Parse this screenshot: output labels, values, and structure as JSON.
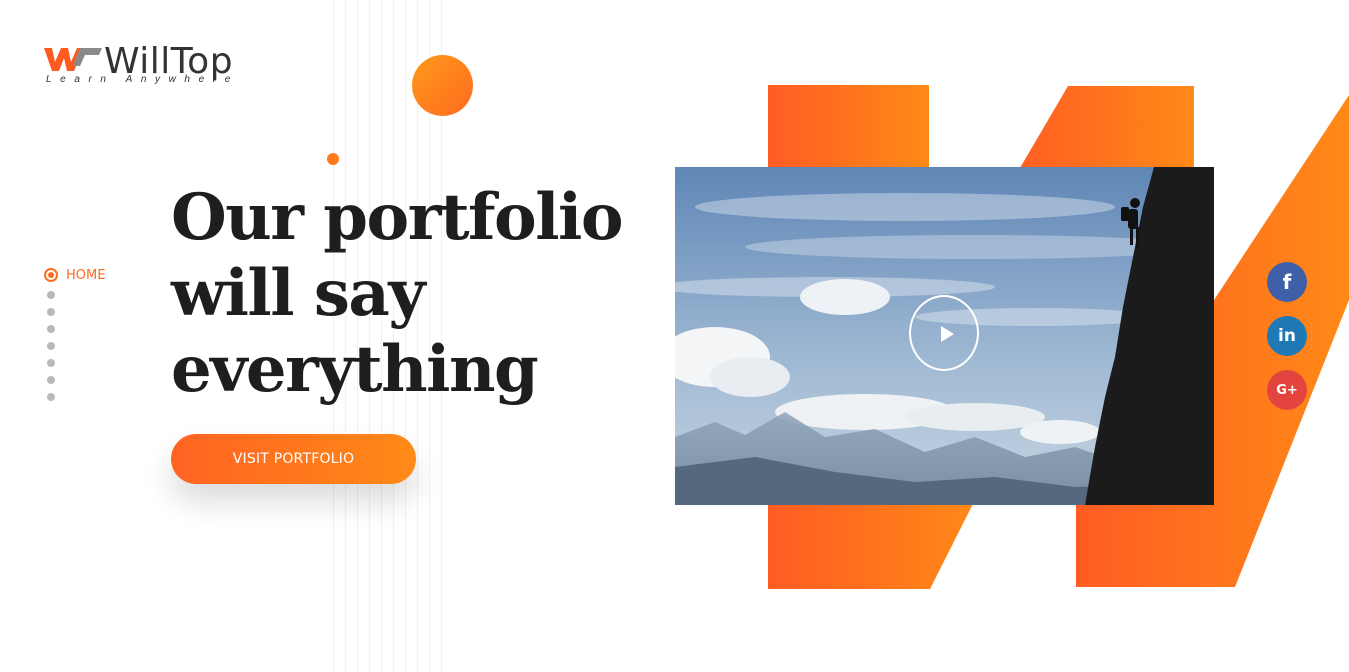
{
  "logo": {
    "mark": "W",
    "name": "WillTop",
    "tagline": "Learn Anywhere"
  },
  "sidenav": {
    "active_label": "HOME",
    "dot_count": 7
  },
  "hero": {
    "heading_lines": [
      "Our portfolio",
      "will say",
      "everything"
    ],
    "cta_label": "VISIT PORTFOLIO"
  },
  "video": {
    "play_icon": "play-icon"
  },
  "social": {
    "facebook_glyph": "f",
    "linkedin_glyph": "in",
    "google_glyph": "G+"
  },
  "colors": {
    "accent": "#ff6a1f",
    "accent_light": "#ff8a17",
    "heading": "#1e1e1e",
    "facebook": "#3f5fa8",
    "linkedin": "#1f79b4",
    "google": "#e3453e"
  }
}
